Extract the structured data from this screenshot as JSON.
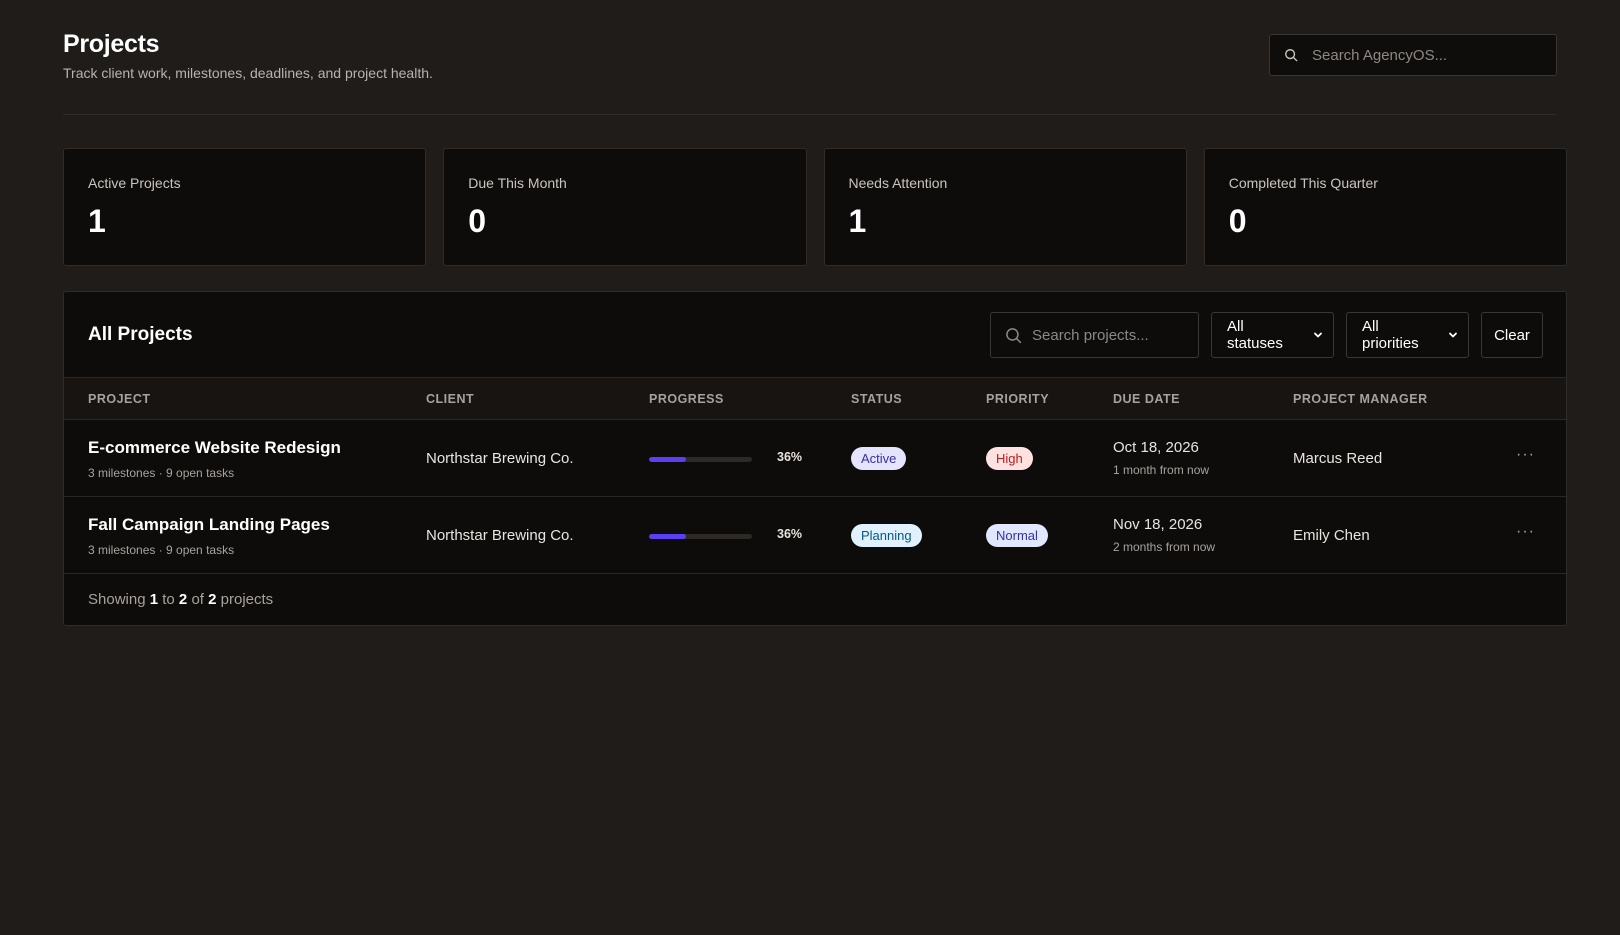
{
  "header": {
    "title": "Projects",
    "subtitle": "Track client work, milestones, deadlines, and project health.",
    "search_placeholder": "Search AgencyOS..."
  },
  "stats": [
    {
      "label": "Active Projects",
      "value": "1"
    },
    {
      "label": "Due This Month",
      "value": "0"
    },
    {
      "label": "Needs Attention",
      "value": "1"
    },
    {
      "label": "Completed This Quarter",
      "value": "0"
    }
  ],
  "panel": {
    "title": "All Projects",
    "search_placeholder": "Search projects...",
    "status_filter": "All statuses",
    "priority_filter": "All priorities",
    "clear_label": "Clear"
  },
  "table": {
    "columns": [
      "PROJECT",
      "CLIENT",
      "PROGRESS",
      "STATUS",
      "PRIORITY",
      "DUE DATE",
      "PROJECT MANAGER"
    ],
    "rows": [
      {
        "name": "E-commerce Website Redesign",
        "meta": "3 milestones · 9 open tasks",
        "client": "Northstar Brewing Co.",
        "progress": 0.36,
        "progress_label": "36%",
        "status": "Active",
        "priority": "High",
        "due_date": "Oct 18, 2026",
        "due_relative": "1 month from now",
        "manager": "Marcus Reed",
        "menu": "···"
      },
      {
        "name": "Fall Campaign Landing Pages",
        "meta": "3 milestones · 9 open tasks",
        "client": "Northstar Brewing Co.",
        "progress": 0.36,
        "progress_label": "36%",
        "status": "Planning",
        "priority": "Normal",
        "due_date": "Nov 18, 2026",
        "due_relative": "2 months from now",
        "manager": "Emily Chen",
        "menu": "···"
      }
    ]
  },
  "footer": {
    "prefix": "Showing",
    "from": "1",
    "to_word": "to",
    "to": "2",
    "of_word": "of",
    "total": "2",
    "suffix": "projects"
  },
  "badge_colors": {
    "Active": {
      "bg": "#e4e4fd",
      "fg": "#3730a3"
    },
    "Planning": {
      "bg": "#e0f2fe",
      "fg": "#075985"
    },
    "High": {
      "bg": "#fee2e2",
      "fg": "#b91c1c"
    },
    "Normal": {
      "bg": "#e0e7ff",
      "fg": "#3730a3"
    }
  },
  "icons": {
    "search": "search-icon",
    "chevron": "chevron-down-icon",
    "more": "more-horizontal-icon"
  }
}
